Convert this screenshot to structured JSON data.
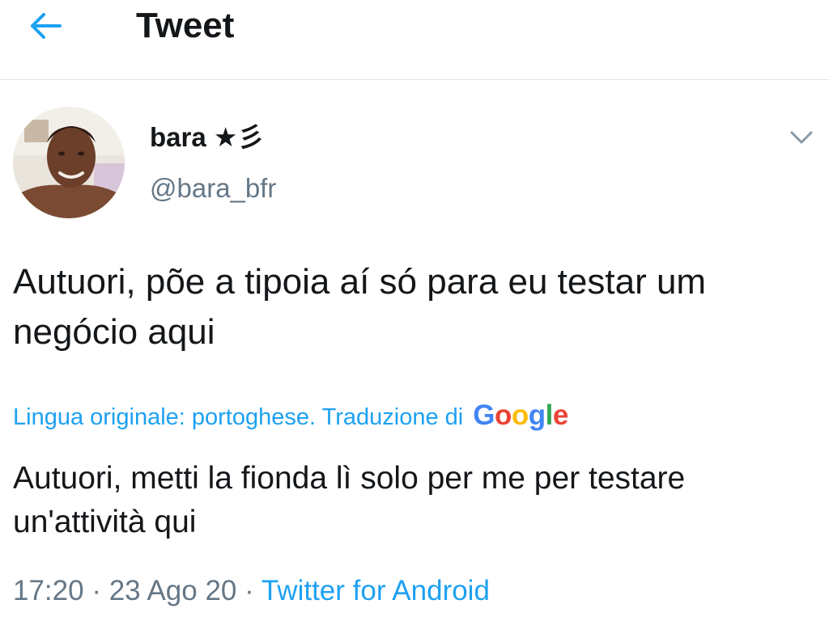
{
  "header": {
    "back_icon": "arrow-left-icon",
    "title": "Tweet"
  },
  "author": {
    "avatar_icon": "profile-photo",
    "display_name": "bara ★彡",
    "handle": "@bara_bfr",
    "menu_icon": "chevron-down-icon"
  },
  "tweet": {
    "text": "Autuori, põe a tipoia aí só para eu testar um negócio aqui"
  },
  "translation": {
    "label": "Lingua originale: portoghese. Traduzione di",
    "provider": "Google",
    "text": "Autuori, metti la fionda lì solo per me per testare un'attività qui"
  },
  "meta": {
    "time": "17:20",
    "separator": "·",
    "date": "23 Ago 20",
    "source": "Twitter for Android"
  },
  "colors": {
    "accent": "#1da1f2",
    "secondary_text": "#657786",
    "primary_text": "#14171a",
    "divider": "#dfe3e6"
  }
}
